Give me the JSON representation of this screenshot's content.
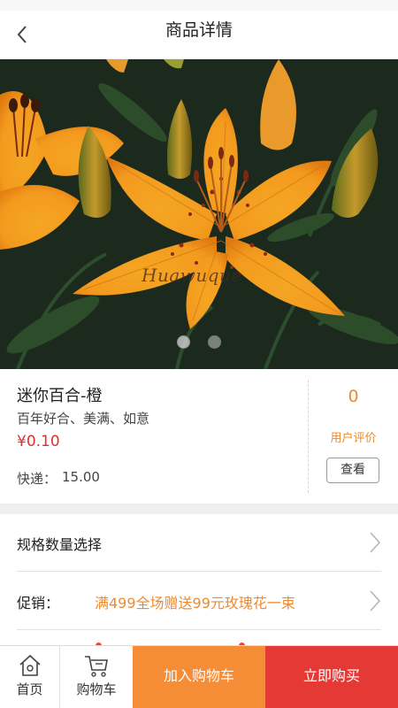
{
  "header": {
    "title": "商品详情",
    "back_icon": "chevron-left-icon"
  },
  "gallery": {
    "watermark": "Huawuque",
    "slide_count": 2,
    "active_slide": 1
  },
  "product": {
    "name": "迷你百合-橙",
    "subtitle": "百年好合、美满、如意",
    "price": "¥0.10",
    "shipping_label": "快递：",
    "shipping_value": "15.00"
  },
  "reviews": {
    "count": "0",
    "label": "用户评价",
    "view_button": "查看"
  },
  "spec_row": {
    "label": "规格数量选择"
  },
  "promo_row": {
    "label": "促销：",
    "value": "满499全场赠送99元玫瑰花一束"
  },
  "tabbar": {
    "home_label": "首页",
    "cart_label": "购物车",
    "add_to_cart": "加入购物车",
    "buy_now": "立即购买"
  },
  "colors": {
    "accent_orange": "#f58d36",
    "price_red": "#e1302f",
    "buy_red": "#e53935"
  }
}
